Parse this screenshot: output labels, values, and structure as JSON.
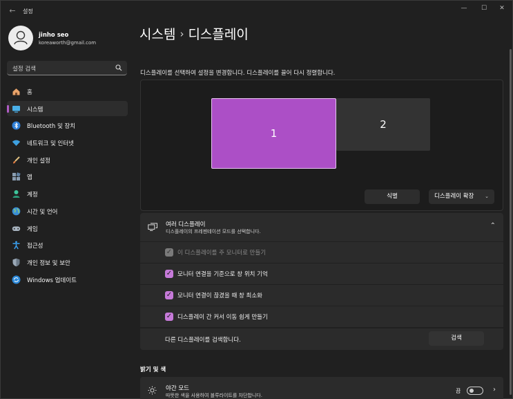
{
  "app": {
    "title": "설정",
    "back_glyph": "←",
    "min_glyph": "—",
    "max_glyph": "☐",
    "close_glyph": "✕"
  },
  "user": {
    "name": "jinho seo",
    "email": "koreaworth@gmail.com"
  },
  "search": {
    "placeholder": "설정 검색"
  },
  "sidebar": {
    "items": [
      {
        "label": "홈",
        "icon": "home-icon"
      },
      {
        "label": "시스템",
        "icon": "system-icon",
        "active": true
      },
      {
        "label": "Bluetooth 및 장치",
        "icon": "bluetooth-icon"
      },
      {
        "label": "네트워크 및 인터넷",
        "icon": "wifi-icon"
      },
      {
        "label": "개인 설정",
        "icon": "brush-icon"
      },
      {
        "label": "앱",
        "icon": "apps-icon"
      },
      {
        "label": "계정",
        "icon": "account-icon"
      },
      {
        "label": "시간 및 언어",
        "icon": "globe-icon"
      },
      {
        "label": "게임",
        "icon": "gamepad-icon"
      },
      {
        "label": "접근성",
        "icon": "accessibility-icon"
      },
      {
        "label": "개인 정보 및 보안",
        "icon": "shield-icon"
      },
      {
        "label": "Windows 업데이트",
        "icon": "update-icon"
      }
    ]
  },
  "header": {
    "parent": "시스템",
    "separator": "›",
    "current": "디스플레이"
  },
  "arrange": {
    "instruction": "디스플레이를 선택하여 설정을 변경합니다. 디스플레이를 끌어 다시 정렬합니다.",
    "monitor_1": "1",
    "monitor_2": "2",
    "identify_label": "식별",
    "extend_label": "디스플레이 확장",
    "extend_chevron": "⌄"
  },
  "multiple_displays": {
    "title": "여러 디스플레이",
    "subtitle": "디스플레이의 프레젠테이션 모드를 선택합니다.",
    "collapse_glyph": "⌃",
    "options": [
      {
        "label": "이 디스플레이를 주 모니터로 만들기",
        "checked": true,
        "disabled": true
      },
      {
        "label": "모니터 연결을 기준으로 창 위치 기억",
        "checked": true,
        "disabled": false
      },
      {
        "label": "모니터 연결이 끊겼을 때 창 최소화",
        "checked": true,
        "disabled": false
      },
      {
        "label": "디스플레이 간 커서 이동 쉽게 만들기",
        "checked": true,
        "disabled": false
      }
    ],
    "check_glyph": "✓",
    "detect_label": "다른 디스플레이를 검색합니다.",
    "detect_button": "검색"
  },
  "brightness": {
    "section_title": "밝기 및 색",
    "night_light_title": "야간 모드",
    "night_light_sub": "따뜻한 색을 사용하여 블루라이트를 차단합니다.",
    "night_light_state": "끔",
    "chevron": "›"
  },
  "colors": {
    "accent": "#ac4fc6",
    "checkbox": "#c67ad9",
    "background": "#202020",
    "card": "#2b2b2b"
  }
}
